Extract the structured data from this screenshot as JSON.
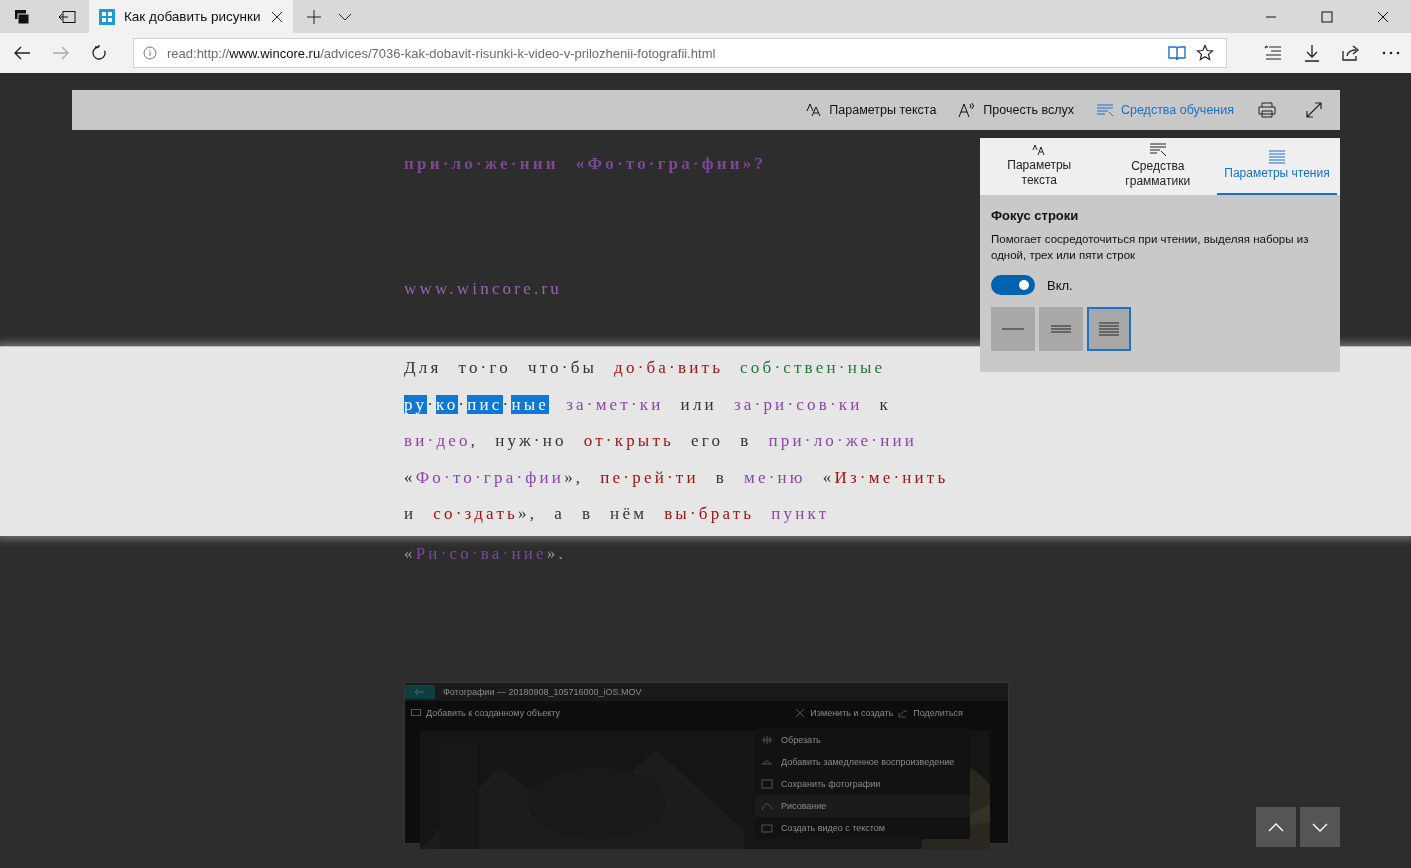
{
  "browser": {
    "tabs": [
      {
        "title": "Как добавить рисунки",
        "selected": true
      }
    ],
    "address": {
      "prefix": "read:http://",
      "host": "www.wincore.ru",
      "path": "/advices/7036-kak-dobavit-risunki-k-video-v-prilozhenii-fotografii.html"
    },
    "forward_disabled": true
  },
  "reader_toolbar": [
    {
      "kind": "text",
      "label": "Параметры текста",
      "selected": false
    },
    {
      "kind": "aloud",
      "label": "Прочесть вслух",
      "selected": false
    },
    {
      "kind": "learning",
      "label": "Средства обучения",
      "selected": true
    }
  ],
  "panel": {
    "tabs": [
      {
        "kind": "text",
        "label": "Параметры текста",
        "selected": false
      },
      {
        "kind": "grammar",
        "label": "Средства грамматики",
        "selected": false
      },
      {
        "kind": "reading",
        "label": "Параметры чтения",
        "selected": true
      }
    ],
    "section_title": "Фокус строки",
    "description": "Помогает сосредоточиться при чтении, выделяя наборы из одной, трех или пяти строк",
    "toggle": {
      "on": true,
      "label": "Вкл."
    },
    "line_options": [
      {
        "kind": "one",
        "selected": false
      },
      {
        "kind": "three",
        "selected": false
      },
      {
        "kind": "five",
        "selected": true
      }
    ]
  },
  "article": {
    "heading": [
      {
        "text": "при·ло·же·нии",
        "color": "#7d4896"
      },
      {
        "text": "Фо·то·гра·фии",
        "color": "#7d4896",
        "prefix": "«",
        "suffix": "»?"
      }
    ],
    "source": "www.wincore.ru",
    "lines": [
      {
        "focused": true,
        "tokens": [
          {
            "text": "Для"
          },
          {
            "text": "то·го"
          },
          {
            "text": "что·бы"
          },
          {
            "text": "до·ба·вить",
            "color": "#a31515"
          },
          {
            "text": "соб·ствен·ные",
            "color": "#1e7a3a"
          }
        ]
      },
      {
        "focused": true,
        "tokens": [
          {
            "text": "ру·ко·пис·ные",
            "selected": true
          },
          {
            "text": "за·мет·ки",
            "color": "#8e44ad"
          },
          {
            "text": "или"
          },
          {
            "text": "за·ри·сов·ки",
            "color": "#8e44ad"
          },
          {
            "text": "к"
          }
        ]
      },
      {
        "focused": true,
        "tokens": [
          {
            "text": "ви·део",
            "color": "#8e44ad",
            "suffix": ","
          },
          {
            "text": "нуж·но"
          },
          {
            "text": "от·крыть",
            "color": "#a31515"
          },
          {
            "text": "его"
          },
          {
            "text": "в"
          },
          {
            "text": "при·ло·же·нии",
            "color": "#8e44ad"
          }
        ]
      },
      {
        "focused": true,
        "tokens": [
          {
            "text": "Фо·то·гра·фии",
            "color": "#8e44ad",
            "prefix": "«",
            "suffix": "»,"
          },
          {
            "text": "пе·рей·ти",
            "color": "#a31515"
          },
          {
            "text": "в"
          },
          {
            "text": "ме·ню",
            "color": "#8e44ad"
          },
          {
            "text": "Из·ме·нить",
            "color": "#a31515",
            "prefix": "«"
          }
        ]
      },
      {
        "focused": true,
        "tokens": [
          {
            "text": "и"
          },
          {
            "text": "со·здать",
            "color": "#a31515",
            "suffix": "»,"
          },
          {
            "text": "а"
          },
          {
            "text": "в"
          },
          {
            "text": "нём"
          },
          {
            "text": "вы·брать",
            "color": "#a31515"
          },
          {
            "text": "пункт",
            "color": "#8e44ad"
          }
        ]
      },
      {
        "focused": false,
        "tokens": [
          {
            "text": "Ри·со·ва·ние",
            "color": "#7d4896",
            "prefix": "«",
            "suffix": "»."
          }
        ]
      }
    ],
    "screenshot": {
      "title": "Фотографии — 20180908_105716000_iOS.MOV",
      "add_label": "Добавить к созданному объекту",
      "edit_label": "Изменить и создать",
      "share_label": "Поделиться",
      "menu": [
        {
          "kind": "trim",
          "label": "Обрезать"
        },
        {
          "kind": "slowmo",
          "label": "Добавить замедленное воспроизведение"
        },
        {
          "kind": "save",
          "label": "Сохранить фотографии"
        },
        {
          "kind": "draw",
          "label": "Рисование"
        },
        {
          "kind": "video",
          "label": "Создать видео с текстом"
        }
      ]
    }
  }
}
